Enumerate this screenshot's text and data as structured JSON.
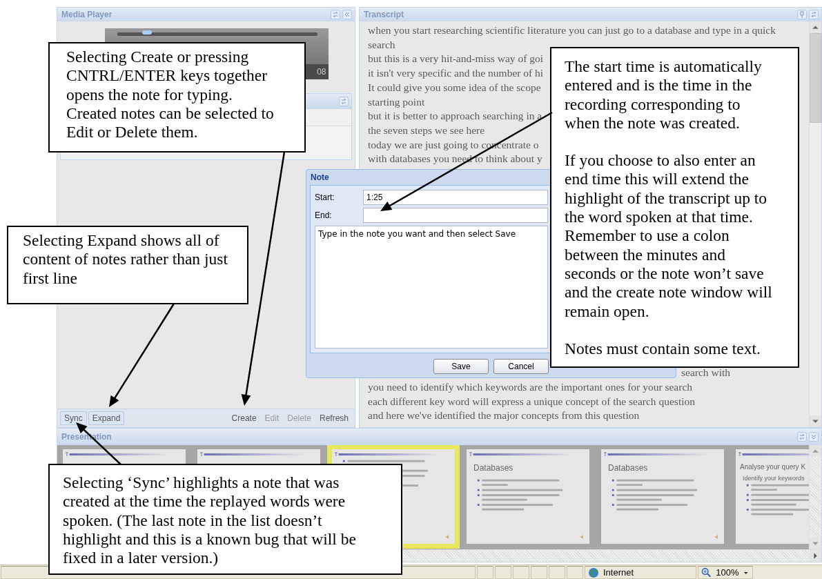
{
  "media_player": {
    "title": "Media Player",
    "time": "08",
    "level": 0.15
  },
  "notes": {
    "toolbar_left": [
      {
        "label": "Sync",
        "disabled": false
      },
      {
        "label": "Expand",
        "disabled": false
      }
    ],
    "toolbar_right": [
      {
        "label": "Create",
        "disabled": false
      },
      {
        "label": "Edit",
        "disabled": true
      },
      {
        "label": "Delete",
        "disabled": true
      },
      {
        "label": "Refresh",
        "disabled": false
      }
    ]
  },
  "transcript": {
    "title": "Transcript",
    "lines_top": [
      "when you start researching scientific literature you can just go to a database and type in a quick search",
      "but this is a very hit-and-miss way of goi",
      "it isn't very specific and the number of hi",
      "It could give you some idea of the scope",
      "starting point",
      "but it is better to approach searching in a",
      "the seven steps we see here",
      "today we are just going to concentrate o",
      "with databases you need to think about y"
    ],
    "lines_bottom": [
      {
        "tail": "search with"
      },
      {
        "text": "you need to identify which keywords are the important ones for your search"
      },
      {
        "text": "each different key word will express a unique concept of the search question"
      },
      {
        "text": "and here we've identified the major concepts from this question"
      }
    ]
  },
  "note_dialog": {
    "title": "Note",
    "start_label": "Start:",
    "start_value": "1:25",
    "end_label": "End:",
    "body": "Type in the note you want and then select Save",
    "buttons": [
      "Save",
      "Cancel"
    ]
  },
  "presentation": {
    "title": "Presentation",
    "slides": [
      {
        "kind": "blank",
        "selected": false
      },
      {
        "kind": "blank",
        "selected": false
      },
      {
        "kind": "text",
        "selected": true
      },
      {
        "kind": "text",
        "title": "Databases",
        "selected": false
      },
      {
        "kind": "text",
        "title": "Databases",
        "selected": false
      },
      {
        "kind": "text",
        "title": "Analyse your query K",
        "points": [
          "Identify your keywords"
        ],
        "selected": false
      }
    ]
  },
  "status_bar": {
    "zone": "Internet",
    "zoom": "100%"
  },
  "callouts": [
    {
      "paragraphs": [
        "Selecting Create or pressing CNTRL/ENTER keys together opens the note for typing. Created notes can be selected to Edit or Delete them."
      ]
    },
    {
      "paragraphs": [
        "The start time is automatically entered and is the time in the recording corresponding to when the note was created.",
        "If you choose to also enter an end time this will extend the highlight of the transcript up to the word spoken at that time. Remember to use a colon between the minutes and seconds or the note won’t save and the create note window will remain open.",
        "Notes must contain some text."
      ]
    },
    {
      "paragraphs": [
        "Selecting Expand shows all of content of notes rather than just first line"
      ]
    },
    {
      "paragraphs": [
        "Selecting ‘Sync’ highlights a note that was created at the time the replayed words were spoken. (The last note in the list doesn’t highlight and this is a known bug that will be fixed in a later version.)"
      ]
    }
  ]
}
